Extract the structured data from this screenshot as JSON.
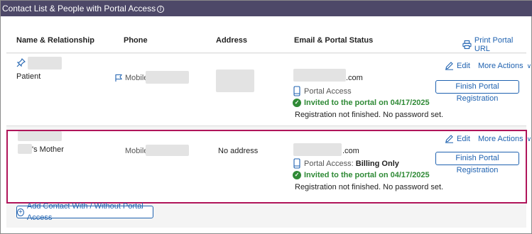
{
  "title": "Contact List & People with Portal Access",
  "headers": {
    "name": "Name & Relationship",
    "phone": "Phone",
    "address": "Address",
    "email": "Email & Portal Status",
    "print": "Print Portal URL"
  },
  "contacts": [
    {
      "relationship": "Patient",
      "phone_label": "Mobile:",
      "email_suffix": ".com",
      "portal_access": "Portal Access",
      "invited": "Invited to the portal on 04/17/2025",
      "registration": "Registration not finished. No password set.",
      "edit": "Edit",
      "more": "More Actions",
      "finish": "Finish Portal Registration"
    },
    {
      "relationship": "'s Mother",
      "phone_label": "Mobile:",
      "address": "No address",
      "email_suffix": ".com",
      "portal_access_prefix": "Portal Access: ",
      "portal_access_value": "Billing Only",
      "invited": "Invited to the portal on 04/17/2025",
      "registration": "Registration not finished. No password set.",
      "edit": "Edit",
      "more": "More Actions",
      "finish": "Finish Portal Registration"
    }
  ],
  "add_contact": "Add Contact With / Without Portal Access",
  "colors": {
    "title_bar": "#4d4868",
    "link": "#1f62b0",
    "success": "#2f8a36",
    "highlight": "#b0155a"
  }
}
